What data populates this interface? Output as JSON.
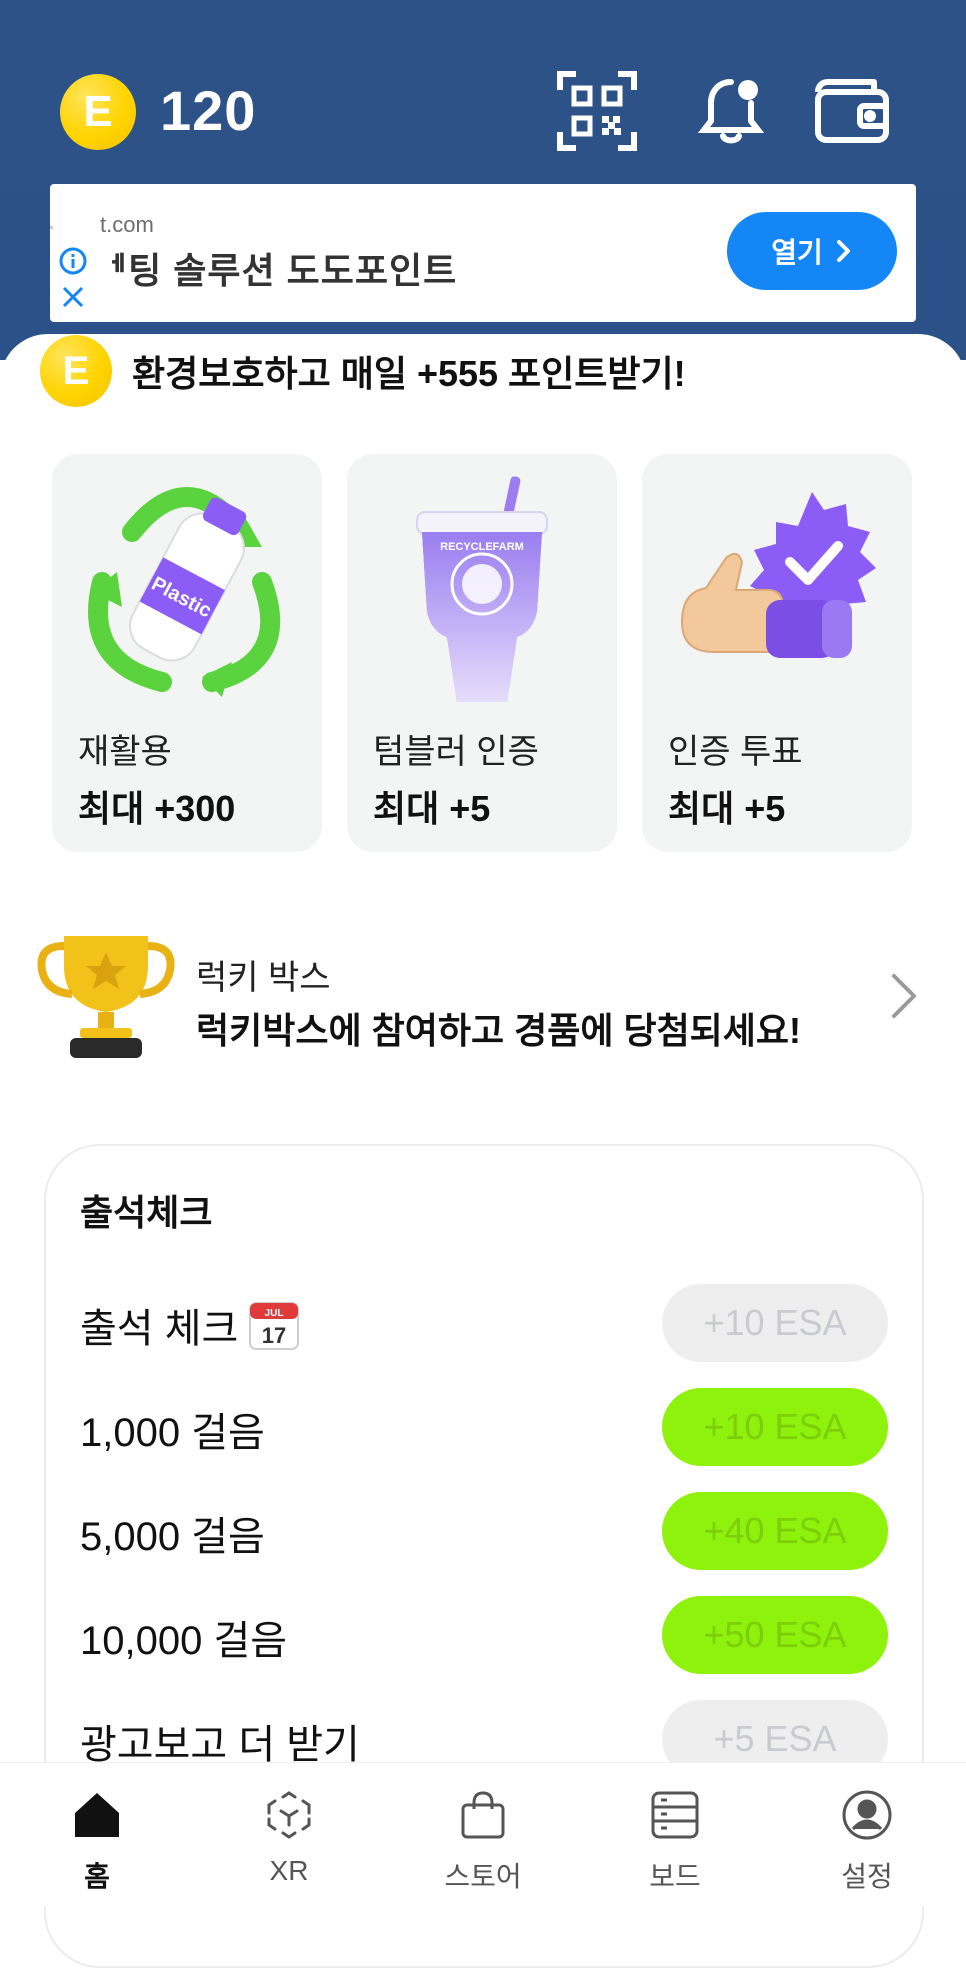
{
  "header": {
    "points": "120",
    "coin_letter": "E"
  },
  "ad": {
    "domain": "t.com",
    "headline": "ᅦ팅 솔루션 도도포인트",
    "open_label": "열기"
  },
  "promo": {
    "coin_letter": "E",
    "text": "환경보호하고 매일 +555 포인트받기!"
  },
  "tiles": [
    {
      "title": "재활용",
      "subtitle": "최대 +300",
      "art_text": "Plastic"
    },
    {
      "title": "텀블러 인증",
      "subtitle": "최대 +5",
      "art_text": "RECYCLEFARM"
    },
    {
      "title": "인증 투표",
      "subtitle": "최대 +5"
    }
  ],
  "lucky_box": {
    "title": "럭키 박스",
    "description": "럭키박스에 참여하고 경품에 당첨되세요!"
  },
  "attendance": {
    "title": "출석체크",
    "calendar_month": "JUL",
    "calendar_day": "17",
    "rows": [
      {
        "label": "출석 체크",
        "reward": "+10 ESA",
        "state": "disabled"
      },
      {
        "label": "1,000 걸음",
        "reward": "+10 ESA",
        "state": "active"
      },
      {
        "label": "5,000 걸음",
        "reward": "+40 ESA",
        "state": "active"
      },
      {
        "label": "10,000 걸음",
        "reward": "+50 ESA",
        "state": "active"
      },
      {
        "label": "광고보고 더 받기",
        "reward": "+5 ESA",
        "state": "disabled"
      }
    ]
  },
  "nav": {
    "items": [
      {
        "label": "홈",
        "icon": "home-icon",
        "active": true
      },
      {
        "label": "XR",
        "icon": "ar-cube-icon",
        "active": false
      },
      {
        "label": "스토어",
        "icon": "shopping-bag-icon",
        "active": false
      },
      {
        "label": "보드",
        "icon": "board-icon",
        "active": false
      },
      {
        "label": "설정",
        "icon": "profile-icon",
        "active": false
      }
    ]
  },
  "colors": {
    "header_bg": "#2d5287",
    "accent_blue": "#1486f5",
    "accent_green": "#8ef20c",
    "coin_yellow": "#ffd400"
  }
}
